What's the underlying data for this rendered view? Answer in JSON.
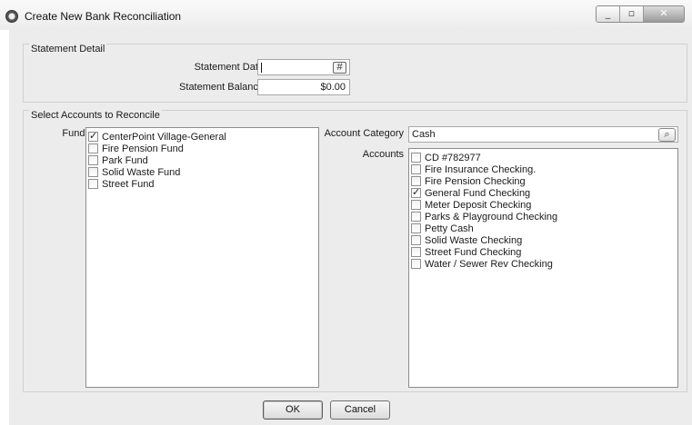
{
  "window": {
    "title": "Create New Bank Reconciliation"
  },
  "statement": {
    "group_title": "Statement Detail",
    "date_label": "Statement Date",
    "date_value": "",
    "balance_label": "Statement Balance",
    "balance_value": "$0.00"
  },
  "accounts_group": {
    "title": "Select Accounts to Reconcile",
    "funds_label": "Funds",
    "funds": [
      {
        "label": "CenterPoint Village-General",
        "checked": true
      },
      {
        "label": "Fire Pension Fund",
        "checked": false
      },
      {
        "label": "Park Fund",
        "checked": false
      },
      {
        "label": "Solid Waste Fund",
        "checked": false
      },
      {
        "label": "Street Fund",
        "checked": false
      }
    ],
    "category_label": "Account Category",
    "category_value": "Cash",
    "accounts_label": "Accounts",
    "accounts": [
      {
        "label": "CD #782977",
        "checked": false
      },
      {
        "label": "Fire Insurance Checking.",
        "checked": false
      },
      {
        "label": "Fire Pension Checking",
        "checked": false
      },
      {
        "label": "General Fund Checking",
        "checked": true
      },
      {
        "label": "Meter Deposit Checking",
        "checked": false
      },
      {
        "label": "Parks & Playground Checking",
        "checked": false
      },
      {
        "label": "Petty Cash",
        "checked": false
      },
      {
        "label": "Solid Waste Checking",
        "checked": false
      },
      {
        "label": "Street Fund Checking",
        "checked": false
      },
      {
        "label": "Water / Sewer Rev Checking",
        "checked": false
      }
    ]
  },
  "buttons": {
    "ok": "OK",
    "cancel": "Cancel"
  },
  "icons": {
    "minimize": "minimize-icon",
    "maximize": "maximize-icon",
    "close": "close-icon",
    "calendar": "calendar-icon",
    "search": "search-icon",
    "help": "help-icon"
  },
  "colors": {
    "window_bg": "#ececec",
    "field_bg": "#ffffff",
    "border": "#a8a8a8"
  }
}
